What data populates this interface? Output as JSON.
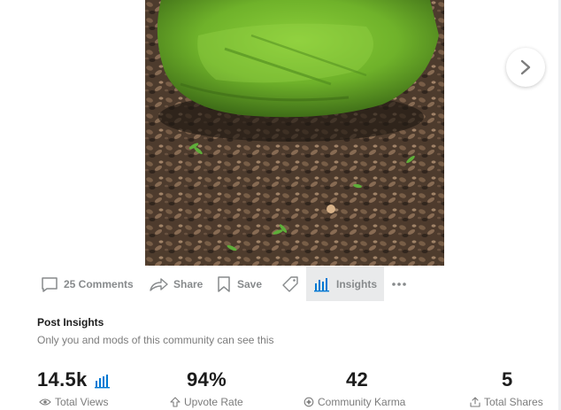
{
  "post": {
    "image_alt": "Moss-covered stone on leaf litter"
  },
  "actions": {
    "comments_label": "25 Comments",
    "share_label": "Share",
    "save_label": "Save",
    "insights_label": "Insights"
  },
  "insights": {
    "title": "Post Insights",
    "subtitle": "Only you and mods of this community can see this",
    "stats": [
      {
        "value": "14.5k",
        "label": "Total Views"
      },
      {
        "value": "94%",
        "label": "Upvote Rate"
      },
      {
        "value": "42",
        "label": "Community Karma"
      },
      {
        "value": "5",
        "label": "Total Shares"
      }
    ]
  },
  "colors": {
    "accent": "#0079d3",
    "muted": "#878a8c",
    "text": "#1c1c1c"
  }
}
